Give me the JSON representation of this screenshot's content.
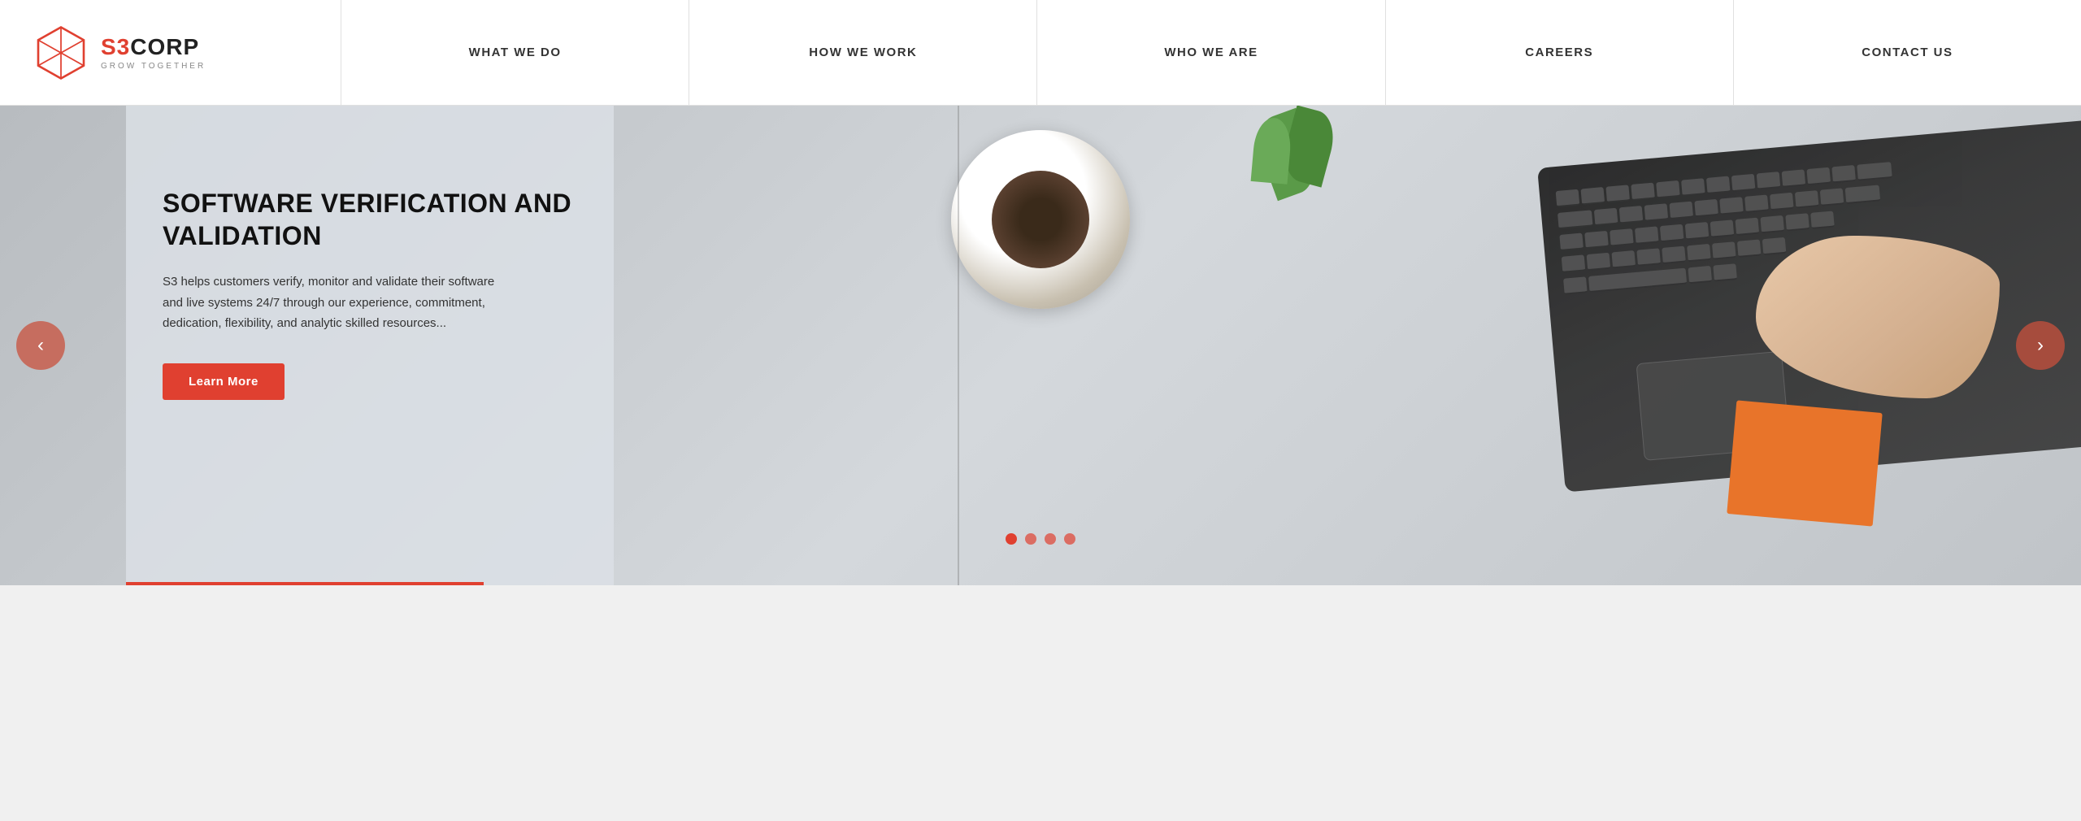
{
  "header": {
    "logo": {
      "brand": "S3",
      "corp": "CORP",
      "tagline": "GROW TOGETHER"
    },
    "nav": {
      "items": [
        {
          "label": "WHAT WE DO",
          "id": "what-we-do"
        },
        {
          "label": "HOW WE WORK",
          "id": "how-we-work"
        },
        {
          "label": "WHO WE ARE",
          "id": "who-we-are"
        },
        {
          "label": "CAREERS",
          "id": "careers"
        },
        {
          "label": "CONTACT US",
          "id": "contact-us"
        }
      ]
    }
  },
  "hero": {
    "slide": {
      "title": "SOFTWARE VERIFICATION AND VALIDATION",
      "description": "S3 helps customers verify, monitor and validate their software and live systems 24/7 through our experience, commitment, dedication, flexibility, and analytic skilled resources...",
      "cta_label": "Learn More"
    },
    "dots_count": 4,
    "arrow_left": "‹",
    "arrow_right": "›"
  }
}
